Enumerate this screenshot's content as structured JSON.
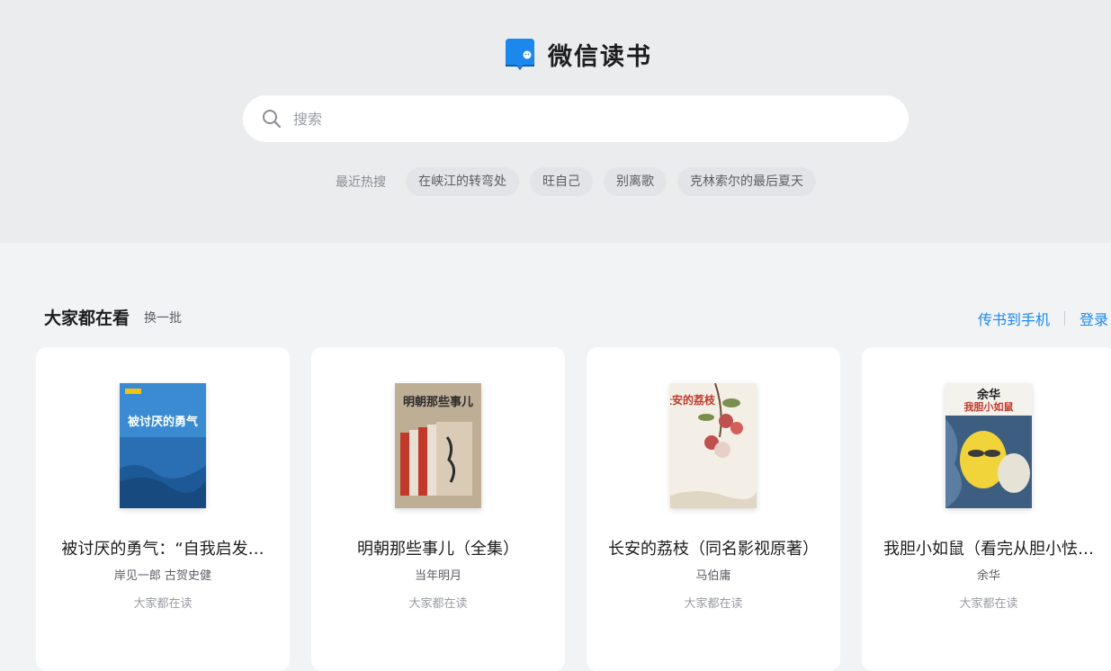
{
  "logo": {
    "text": "微信读书",
    "icon": "wechat-read-book-icon",
    "accent": "#1b88ee"
  },
  "search": {
    "placeholder": "搜索",
    "icon": "search-icon"
  },
  "hot_search": {
    "label": "最近热搜",
    "tags": [
      "在峡江的转弯处",
      "旺自己",
      "别离歌",
      "克林索尔的最后夏天"
    ]
  },
  "section": {
    "title": "大家都在看",
    "refresh_label": "换一批",
    "send_to_phone": "传书到手机",
    "login": "登录"
  },
  "books": [
    {
      "title": "被讨厌的勇气：“自我启发…",
      "author": "岸见一郎 古贺史健",
      "reading": "大家都在读",
      "cover_title": "被讨厌的勇气",
      "cover_color": "#2a6fb3"
    },
    {
      "title": "明朝那些事儿（全集）",
      "author": "当年明月",
      "reading": "大家都在读",
      "cover_title": "明朝那些事儿",
      "cover_color": "#b9a58c"
    },
    {
      "title": "长安的荔枝（同名影视原著）",
      "author": "马伯庸",
      "reading": "大家都在读",
      "cover_title": "长安的荔枝",
      "cover_color": "#f4efe6"
    },
    {
      "title": "我胆小如鼠（看完从胆小怯…",
      "author": "余华",
      "reading": "大家都在读",
      "cover_title": "我胆小如鼠",
      "cover_author": "余华",
      "cover_color": "#3d5e80"
    }
  ]
}
